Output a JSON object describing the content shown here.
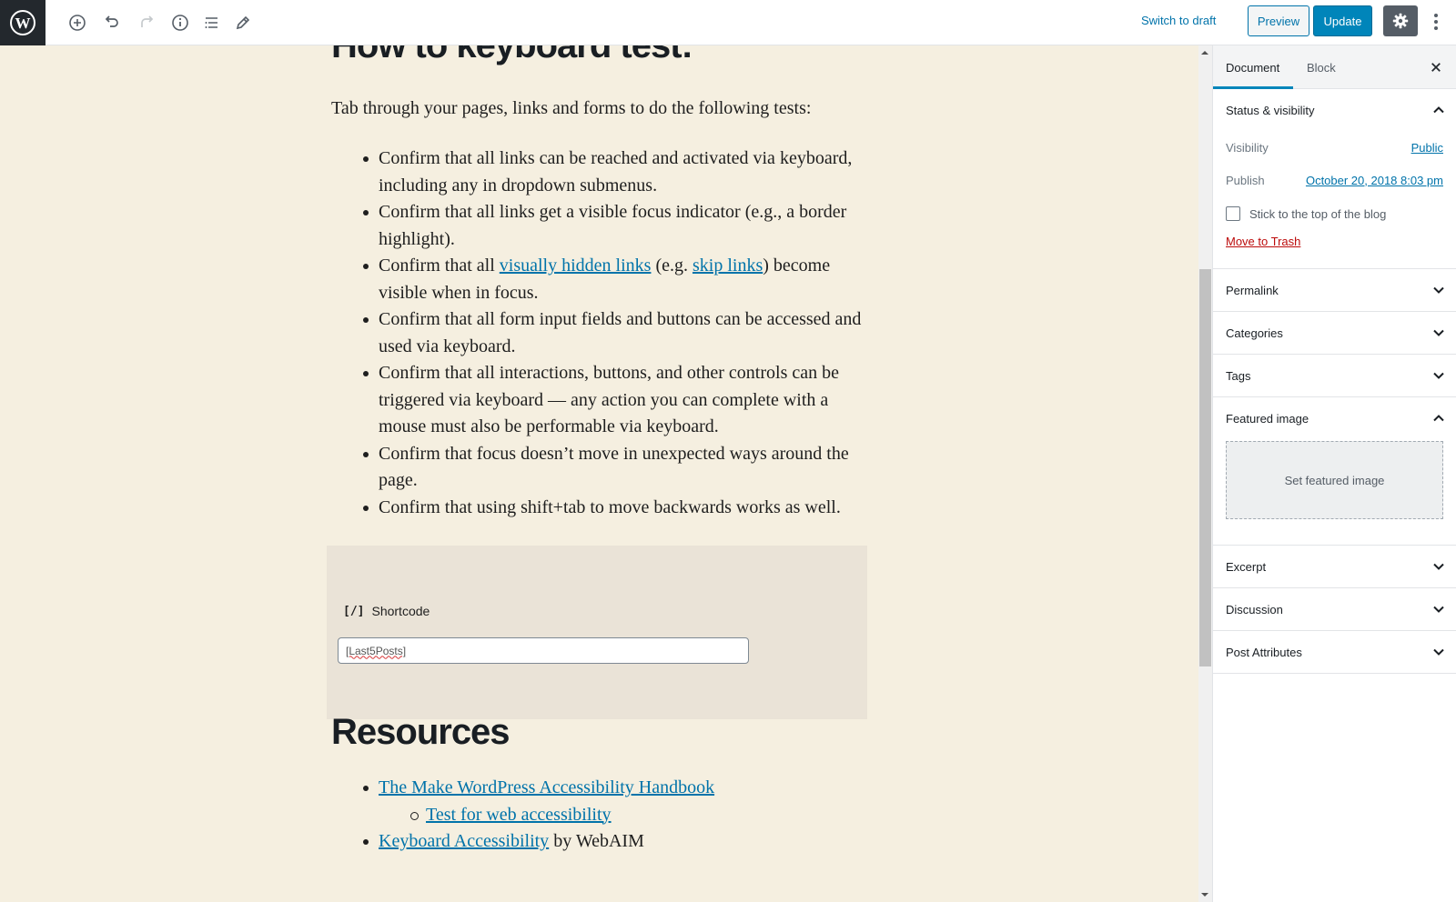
{
  "toolbar": {
    "logo": "wordpress-logo",
    "icons": [
      "add-block-icon",
      "undo-icon",
      "redo-icon",
      "info-icon",
      "outline-icon",
      "edit-tools-icon"
    ],
    "switch_to_draft": "Switch to draft",
    "preview": "Preview",
    "update": "Update",
    "settings": "gear-icon",
    "more": "more-vertical-icon"
  },
  "editor": {
    "heading_clipped": "How to keyboard test:",
    "intro": "Tab through your pages, links and forms to do the following tests:",
    "bullets": [
      {
        "text": "Confirm that all links can be reached and activated via keyboard, including any in dropdown submenus."
      },
      {
        "text": "Confirm that all links get a visible focus indicator (e.g., a border highlight)."
      },
      {
        "pre": "Confirm that all ",
        "link1": "visually hidden links",
        "mid": " (e.g. ",
        "link2": "skip links",
        "post": ") become visible when in focus."
      },
      {
        "text": "Confirm that all form input fields and buttons can be accessed and used via keyboard."
      },
      {
        "text": "Confirm that all interactions, buttons, and other controls can be triggered via keyboard — any action you can complete with a mouse must also be performable via keyboard."
      },
      {
        "text": "Confirm that focus doesn’t move in unexpected ways around the page."
      },
      {
        "text": "Confirm that using shift+tab to move backwards works as well."
      }
    ],
    "shortcode": {
      "icon": "[/]",
      "label": "Shortcode",
      "value": "[Last5Posts]"
    },
    "resources_heading": "Resources",
    "resources": [
      {
        "link": "The Make WordPress Accessibility Handbook ",
        "suffix": ""
      },
      {
        "link": "Test for web accessibility",
        "suffix": "",
        "sub": true
      },
      {
        "link": "Keyboard Accessibility",
        "suffix": " by WebAIM"
      }
    ]
  },
  "sidebar": {
    "tabs": [
      {
        "label": "Document",
        "active": true
      },
      {
        "label": "Block",
        "active": false
      }
    ],
    "close": "close-icon",
    "status": {
      "title": "Status & visibility",
      "expanded": true,
      "visibility_label": "Visibility",
      "visibility_value": "Public",
      "publish_label": "Publish",
      "publish_value": "October 20, 2018 8:03 pm",
      "sticky_label": "Stick to the top of the blog",
      "sticky_checked": false,
      "trash": "Move to Trash"
    },
    "panels": [
      {
        "title": "Permalink",
        "expanded": false
      },
      {
        "title": "Categories",
        "expanded": false
      },
      {
        "title": "Tags",
        "expanded": false
      },
      {
        "title": "Featured image",
        "expanded": true,
        "button": "Set featured image"
      },
      {
        "title": "Excerpt",
        "expanded": false
      },
      {
        "title": "Discussion",
        "expanded": false
      },
      {
        "title": "Post Attributes",
        "expanded": false
      }
    ]
  },
  "colors": {
    "accent": "#0085ba",
    "link": "#0073aa",
    "trash": "#bc0b0b",
    "editor_bg": "#f5efe0",
    "shortcode_bg": "#eae3d7",
    "logo_bg": "#23282d"
  }
}
